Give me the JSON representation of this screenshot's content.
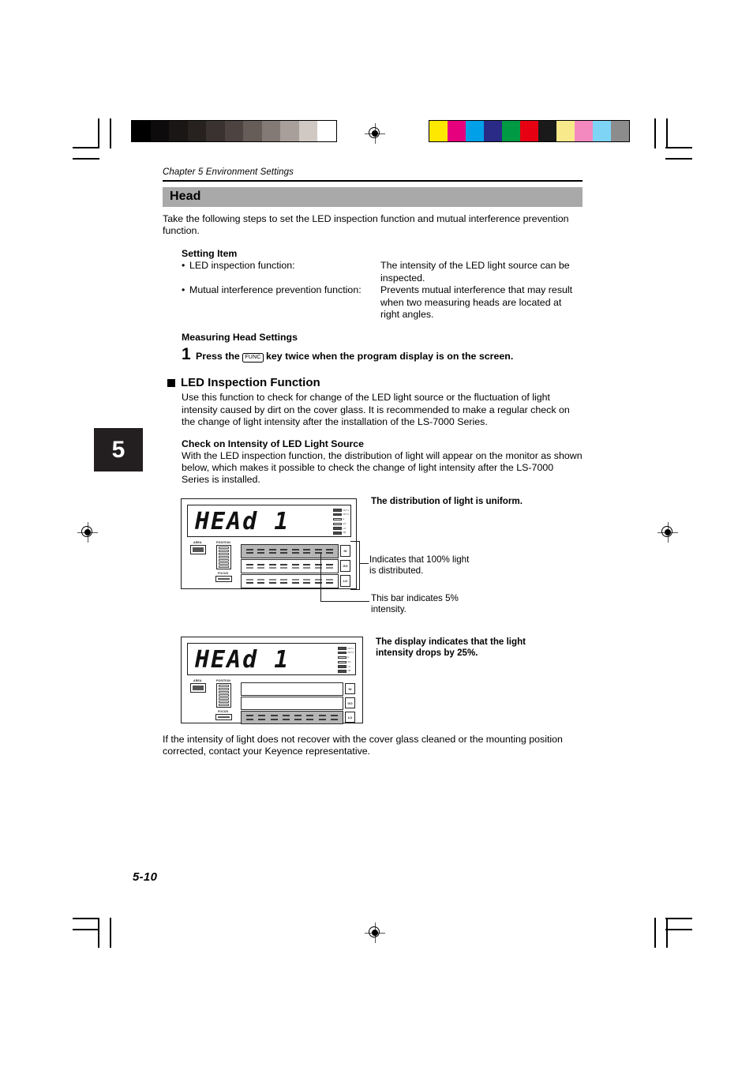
{
  "page": {
    "running_head": "Chapter 5  Environment Settings",
    "chapter_tab": "5",
    "page_number": "5-10"
  },
  "section": {
    "title": "Head",
    "intro": "Take the following steps to set the LED inspection function and mutual interference prevention function."
  },
  "setting_item": {
    "heading": "Setting Item",
    "rows": [
      {
        "bullet": "•",
        "term": "LED inspection function:",
        "desc": "The intensity of the LED light source can be inspected."
      },
      {
        "bullet": "•",
        "term": "Mutual interference prevention function:",
        "desc": "Prevents mutual interference that may result when two measuring heads are located at right angles."
      }
    ]
  },
  "measuring_head": {
    "heading": "Measuring Head Settings",
    "step_number": "1",
    "step_text_before": "Press the",
    "step_key": "FUNC",
    "step_text_after": "key twice when the program display is on the screen."
  },
  "led_inspection": {
    "heading": "LED Inspection Function",
    "body": "Use this function to check for change of the LED light source or the fluctuation of light intensity caused by dirt on  the cover glass. It is recommended to make a regular check on the change of light intensity after the installation of the LS-7000 Series.",
    "subheading": "Check on Intensity of LED Light Source",
    "sub_body": "With the LED inspection function, the distribution of light will appear on the monitor as shown below, which makes it possible to check the change of light intensity after the LS-7000 Series is installed."
  },
  "figure1": {
    "display_text": "HEAd 1",
    "panel_labels": {
      "area": "AREA",
      "position": "POSITION",
      "focus": "FOCUS"
    },
    "judge_labels": [
      "HI",
      "GO",
      "LO"
    ],
    "led_labels": [
      "OUT 1",
      "OUT 2",
      "H",
      "GO",
      "LO",
      "TM"
    ],
    "callout_title": "The distribution of light is uniform.",
    "callout_bracket": "Indicates that 100% light is distributed.",
    "callout_bar": "This bar indicates 5% intensity."
  },
  "figure2": {
    "display_text": "HEAd 1",
    "panel_labels": {
      "area": "AREA",
      "position": "POSITION",
      "focus": "FOCUS"
    },
    "judge_labels": [
      "HI",
      "GO",
      "LO"
    ],
    "led_labels": [
      "OUT 1",
      "OUT 2",
      "H",
      "GO",
      "LO",
      "TM"
    ],
    "callout_title": "The display indicates that the light intensity drops by 25%."
  },
  "closing": {
    "text": "If the intensity of light does not recover with the cover glass cleaned or the mounting position corrected, contact your Keyence representative."
  },
  "calibration": {
    "grayscale": [
      "#000000",
      "#0d0b0b",
      "#1a1616",
      "#272120",
      "#3a3230",
      "#4d4341",
      "#665c58",
      "#847a75",
      "#a89f9a",
      "#cfc8c3",
      "#ffffff"
    ],
    "colors": [
      "#ffe800",
      "#e6007e",
      "#00a0e9",
      "#2a2a87",
      "#009944",
      "#e60012",
      "#1a1a1a",
      "#f8e98a",
      "#f489c0",
      "#7ed4f5",
      "#8c8c8c"
    ]
  }
}
